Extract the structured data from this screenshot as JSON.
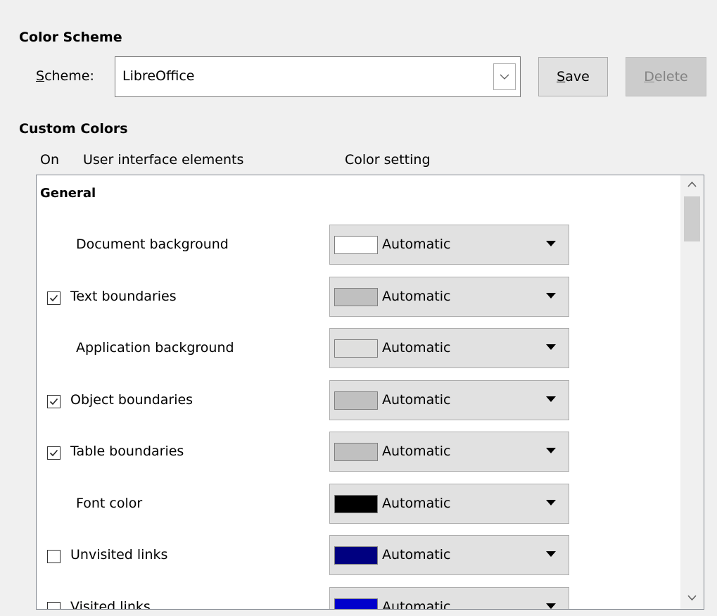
{
  "color_scheme": {
    "title": "Color Scheme",
    "scheme_label": "Scheme:",
    "scheme_value": "LibreOffice",
    "save_label": "Save",
    "delete_label": "Delete"
  },
  "custom_colors": {
    "title": "Custom Colors",
    "columns": {
      "on": "On",
      "elements": "User interface elements",
      "setting": "Color setting"
    },
    "group_general": "General",
    "rows": [
      {
        "label": "Document background",
        "checkbox": false,
        "checked": false,
        "setting": "Automatic",
        "swatch": "#ffffff"
      },
      {
        "label": "Text boundaries",
        "checkbox": true,
        "checked": true,
        "setting": "Automatic",
        "swatch": "#c0c0c0"
      },
      {
        "label": "Application background",
        "checkbox": false,
        "checked": false,
        "setting": "Automatic",
        "swatch": "#dfdfde"
      },
      {
        "label": "Object boundaries",
        "checkbox": true,
        "checked": true,
        "setting": "Automatic",
        "swatch": "#c0c0c0"
      },
      {
        "label": "Table boundaries",
        "checkbox": true,
        "checked": true,
        "setting": "Automatic",
        "swatch": "#c0c0c0"
      },
      {
        "label": "Font color",
        "checkbox": false,
        "checked": false,
        "setting": "Automatic",
        "swatch": "#000000"
      },
      {
        "label": "Unvisited links",
        "checkbox": true,
        "checked": false,
        "setting": "Automatic",
        "swatch": "#000080"
      },
      {
        "label": "Visited links",
        "checkbox": true,
        "checked": false,
        "setting": "Automatic",
        "swatch": "#0000cc"
      }
    ]
  }
}
